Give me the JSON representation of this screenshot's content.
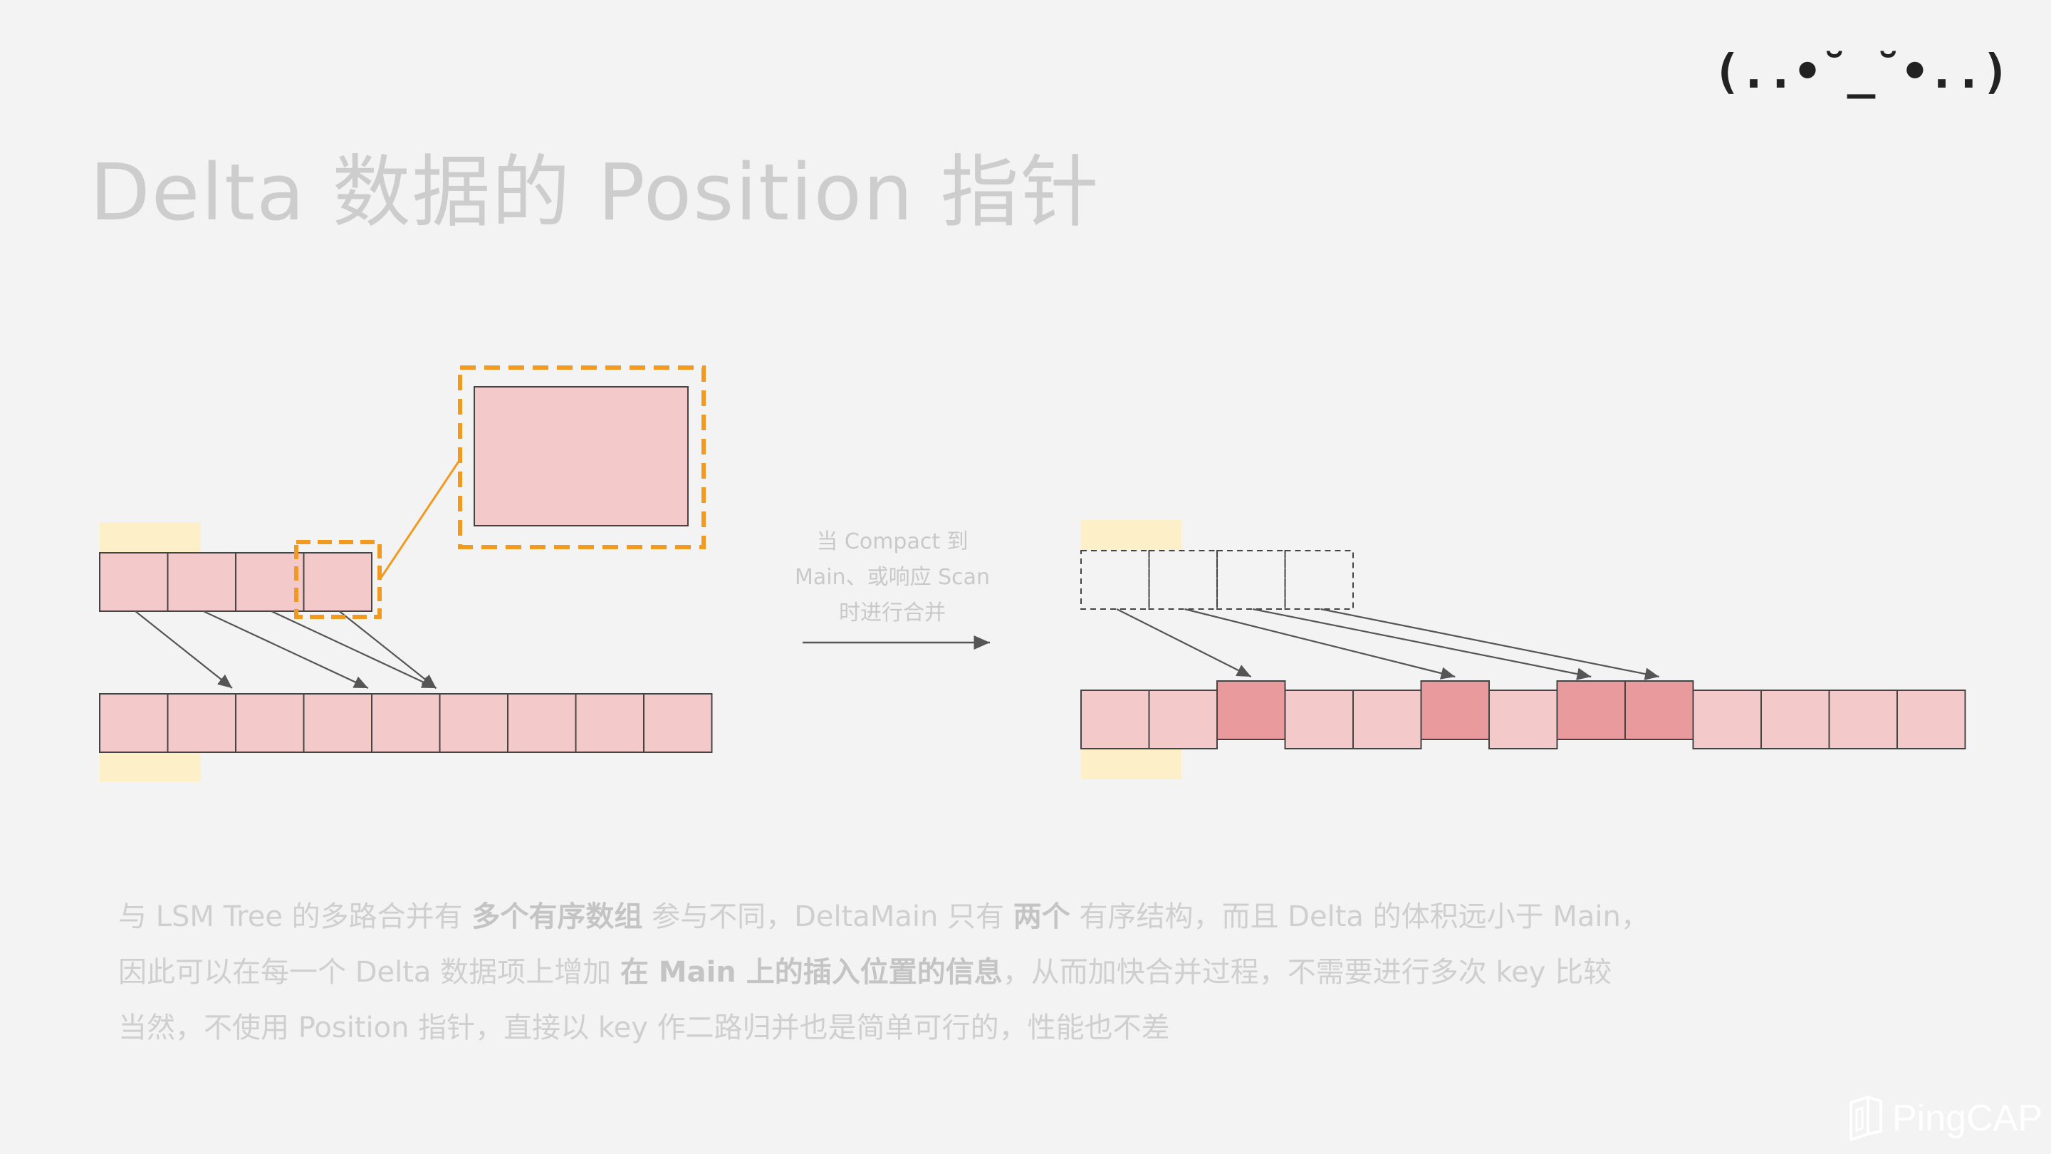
{
  "corner": {
    "kaomoji": "(..•˘_˘•..)"
  },
  "slide": {
    "title": "Delta 数据的 Position 指针"
  },
  "diagram": {
    "arrow_label_lines": [
      "当 Compact 到",
      "Main、或响应 Scan",
      "时进行合并"
    ],
    "left_delta_count": 4,
    "left_main_count": 9,
    "left_pointers": [
      [
        0,
        2
      ],
      [
        1,
        4
      ],
      [
        2,
        5
      ],
      [
        3,
        5
      ]
    ],
    "right_delta_count": 4,
    "right_main_count": 13,
    "right_inserted_positions": [
      2,
      5,
      7,
      8
    ],
    "colors": {
      "cell_fill": "#f4c9ca",
      "inserted_fill": "#e89a9c",
      "cell_stroke": "#444444",
      "highlight": "#fdf0c8",
      "zoom_border": "#f29a1f",
      "pointer": "#555555"
    }
  },
  "paragraph": {
    "line1": {
      "a": "与 LSM Tree 的多路合并有 ",
      "b": "多个有序数组",
      "c": " 参与不同，DeltaMain 只有 ",
      "d": "两个",
      "e": " 有序结构，而且 Delta 的体积远小于 Main，"
    },
    "line2": {
      "a": "因此可以在每一个 Delta 数据项上增加 ",
      "b": "在 Main 上的插入位置的信息",
      "c": "，从而加快合并过程，不需要进行多次 key 比较"
    },
    "line3": "当然，不使用 Position 指针，直接以 key 作二路归并也是简单可行的，性能也不差"
  },
  "logo": {
    "text": "PingCAP",
    "icon": "pingcap-logo-icon"
  }
}
